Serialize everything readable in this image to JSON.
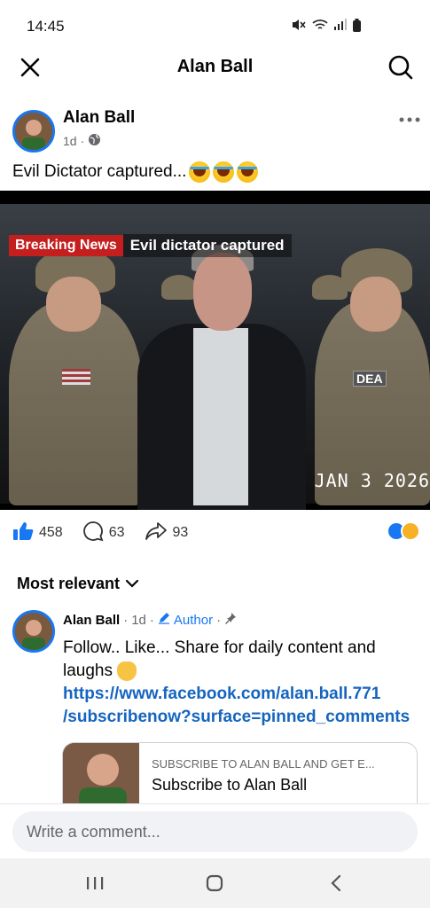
{
  "status_bar": {
    "time": "14:45"
  },
  "header": {
    "title": "Alan Ball"
  },
  "post": {
    "author": "Alan Ball",
    "time": "1d",
    "separator": "·",
    "text": "Evil Dictator captured...",
    "media": {
      "breaking_label": "Breaking News",
      "headline": "Evil dictator captured",
      "patch_text": "DEA",
      "date_stamp": "JAN 3 2026"
    },
    "reactions": {
      "likes": "458",
      "comments": "63",
      "shares": "93"
    }
  },
  "comments_section": {
    "sort_label": "Most relevant",
    "pinned_comment": {
      "author": "Alan Ball",
      "time": "1d",
      "author_badge": "Author",
      "body": "Follow.. Like... Share for daily content and laughs",
      "link_line1": "https://www.facebook.com/alan.ball.771",
      "link_line2": "/subscribenow?surface=pinned_comments",
      "card": {
        "subtitle": "SUBSCRIBE TO ALAN BALL AND GET E...",
        "title": "Subscribe to Alan Ball"
      }
    }
  },
  "composer": {
    "placeholder": "Write a comment..."
  },
  "colors": {
    "brand_blue": "#1877f2",
    "breaking_red": "#c41e1e",
    "link_blue": "#1565c0"
  },
  "icons": [
    "mute-icon",
    "wifi-icon",
    "signal-icon",
    "battery-icon",
    "close-icon",
    "search-icon",
    "globe-icon",
    "more-icon",
    "like-icon",
    "comment-icon",
    "share-icon",
    "chevron-down-icon",
    "pencil-icon",
    "pin-icon",
    "recents-icon",
    "home-icon",
    "back-icon"
  ]
}
